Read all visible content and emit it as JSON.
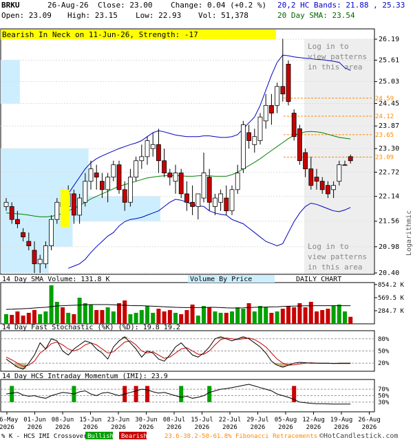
{
  "chart_data": {
    "type": "candlestick",
    "symbol": "BRKU",
    "header": {
      "date": "26-Aug-26",
      "close_label": "Close: 23.00",
      "change_label": "Change: 0.04 (+0.2 %)",
      "open_label": "Open: 23.09",
      "high_label": "High: 23.15",
      "low_label": "Low: 22.93",
      "vol_label": "Vol: 51,378",
      "bands_label": "20,2 HC Bands: 21.88 , 25.33",
      "sma_label": "20 Day SMA: 23.54"
    },
    "pattern_label": "Bearish In Neck on 11-Jun-26, Strength: -17",
    "login_label": "Log in to view patterns in this area",
    "price_axis": {
      "ticks": [
        "26.19",
        "25.61",
        "25.03",
        "24.45",
        "23.87",
        "23.30",
        "22.72",
        "22.14",
        "21.56",
        "20.98",
        "20.40"
      ],
      "scale_label": "Logarithmic",
      "ymin": 20.4,
      "ymax": 26.19
    },
    "fib_levels": [
      "24.59",
      "24.12",
      "23.65",
      "23.09"
    ],
    "x_ticks": [
      "26-May 2026",
      "01-Jun 2026",
      "08-Jun 2026",
      "15-Jun 2026",
      "23-Jun 2026",
      "30-Jun 2026",
      "08-Jul 2026",
      "15-Jul 2026",
      "22-Jul 2026",
      "29-Jul 2026",
      "05-Aug 2026",
      "12-Aug 2026",
      "19-Aug 2026",
      "26-Aug 2026"
    ],
    "candles": [
      [
        21.9,
        22.1,
        21.8,
        22.0
      ],
      [
        21.9,
        22.0,
        21.5,
        21.6
      ],
      [
        21.6,
        21.8,
        21.4,
        21.5
      ],
      [
        21.3,
        21.4,
        21.1,
        21.2
      ],
      [
        21.1,
        21.3,
        20.9,
        21.0
      ],
      [
        20.9,
        21.1,
        20.4,
        20.6
      ],
      [
        20.6,
        20.8,
        20.4,
        20.7
      ],
      [
        20.6,
        21.1,
        20.5,
        21.0
      ],
      [
        21.0,
        21.7,
        20.9,
        21.6
      ],
      [
        21.6,
        22.1,
        21.5,
        22.0
      ],
      [
        22.0,
        22.3,
        21.7,
        21.9
      ],
      [
        21.9,
        22.4,
        21.8,
        22.2
      ],
      [
        22.2,
        22.3,
        21.5,
        21.7
      ],
      [
        21.7,
        22.2,
        21.5,
        22.1
      ],
      [
        22.0,
        22.7,
        21.9,
        22.5
      ],
      [
        22.5,
        23.0,
        22.3,
        22.8
      ],
      [
        22.7,
        22.9,
        22.3,
        22.6
      ],
      [
        22.5,
        22.7,
        22.1,
        22.3
      ],
      [
        22.3,
        22.7,
        22.0,
        22.6
      ],
      [
        22.6,
        23.0,
        22.5,
        22.9
      ],
      [
        22.9,
        23.0,
        22.2,
        22.3
      ],
      [
        22.3,
        22.5,
        21.8,
        22.0
      ],
      [
        22.0,
        22.8,
        21.9,
        22.6
      ],
      [
        22.6,
        23.1,
        22.5,
        23.0
      ],
      [
        23.0,
        23.4,
        22.8,
        23.1
      ],
      [
        23.1,
        23.6,
        22.9,
        23.5
      ],
      [
        23.3,
        23.7,
        23.1,
        23.4
      ],
      [
        23.4,
        23.8,
        22.7,
        23.0
      ],
      [
        23.0,
        23.3,
        22.6,
        22.7
      ],
      [
        22.7,
        22.8,
        22.4,
        22.6
      ],
      [
        22.5,
        22.9,
        22.2,
        22.7
      ],
      [
        22.7,
        22.8,
        22.1,
        22.2
      ],
      [
        22.2,
        22.5,
        21.8,
        22.0
      ],
      [
        22.0,
        22.4,
        21.7,
        21.9
      ],
      [
        21.9,
        22.1,
        21.6,
        22.2
      ],
      [
        22.1,
        23.2,
        22.0,
        22.7
      ],
      [
        22.6,
        22.8,
        21.8,
        22.0
      ],
      [
        21.9,
        22.2,
        21.7,
        22.1
      ],
      [
        22.0,
        22.3,
        21.8,
        22.2
      ],
      [
        22.1,
        22.4,
        21.7,
        21.8
      ],
      [
        21.8,
        22.4,
        21.7,
        22.3
      ],
      [
        22.3,
        22.9,
        22.2,
        22.7
      ],
      [
        22.8,
        24.0,
        22.7,
        23.9
      ],
      [
        23.7,
        23.9,
        23.3,
        23.5
      ],
      [
        23.4,
        23.8,
        23.2,
        23.6
      ],
      [
        23.5,
        24.2,
        23.4,
        24.1
      ],
      [
        24.0,
        24.7,
        23.8,
        24.4
      ],
      [
        24.4,
        24.7,
        23.9,
        24.2
      ],
      [
        24.4,
        25.0,
        24.2,
        24.9
      ],
      [
        24.9,
        26.2,
        24.5,
        24.7
      ],
      [
        25.5,
        25.6,
        24.4,
        24.5
      ],
      [
        24.2,
        24.3,
        23.5,
        23.6
      ],
      [
        23.8,
        23.9,
        22.9,
        23.0
      ],
      [
        23.2,
        23.3,
        22.6,
        22.8
      ],
      [
        22.8,
        23.1,
        22.3,
        22.4
      ],
      [
        22.6,
        22.8,
        22.3,
        22.5
      ],
      [
        22.5,
        22.6,
        22.2,
        22.3
      ],
      [
        22.4,
        22.5,
        22.1,
        22.2
      ],
      [
        22.3,
        22.5,
        22.1,
        22.4
      ],
      [
        22.5,
        23.0,
        22.4,
        22.9
      ],
      [
        22.9,
        23.0,
        22.9,
        22.9
      ],
      [
        23.1,
        23.15,
        22.93,
        23.0
      ]
    ],
    "sma20": [
      21.75,
      21.74,
      21.73,
      21.72,
      21.7,
      21.68,
      21.66,
      21.66,
      21.67,
      21.7,
      21.74,
      21.8,
      21.86,
      21.92,
      22.0,
      22.08,
      22.14,
      22.2,
      22.26,
      22.32,
      22.38,
      22.42,
      22.46,
      22.5,
      22.54,
      22.58,
      22.6,
      22.62,
      22.63,
      22.64,
      22.64,
      22.63,
      22.62,
      22.62,
      22.63,
      22.64,
      22.63,
      22.62,
      22.62,
      22.62,
      22.66,
      22.72,
      22.8,
      22.88,
      22.96,
      23.05,
      23.15,
      23.25,
      23.35,
      23.45,
      23.55,
      23.63,
      23.68,
      23.72,
      23.73,
      23.72,
      23.7,
      23.66,
      23.62,
      23.58,
      23.56,
      23.54
    ],
    "upper_band": [
      null,
      null,
      null,
      null,
      null,
      null,
      null,
      null,
      null,
      null,
      null,
      22.2,
      22.4,
      22.6,
      22.8,
      22.95,
      23.05,
      23.12,
      23.18,
      23.24,
      23.3,
      23.35,
      23.4,
      23.44,
      23.5,
      23.6,
      23.7,
      23.75,
      23.72,
      23.68,
      23.64,
      23.62,
      23.6,
      23.6,
      23.6,
      23.62,
      23.62,
      23.6,
      23.58,
      23.58,
      23.6,
      23.65,
      23.8,
      23.95,
      24.1,
      24.4,
      24.8,
      25.2,
      25.55,
      25.75,
      25.73,
      25.7,
      25.68,
      25.66,
      25.65,
      25.63,
      25.62,
      25.6,
      25.58,
      25.55,
      25.4,
      25.33
    ],
    "lower_band": [
      null,
      null,
      null,
      null,
      null,
      null,
      null,
      null,
      null,
      null,
      null,
      20.5,
      20.55,
      20.6,
      20.7,
      20.85,
      20.98,
      21.1,
      21.22,
      21.3,
      21.45,
      21.55,
      21.6,
      21.62,
      21.65,
      21.7,
      21.75,
      21.8,
      21.9,
      22.0,
      22.07,
      22.05,
      22.0,
      21.95,
      21.92,
      21.9,
      21.8,
      21.75,
      21.72,
      21.7,
      21.6,
      21.55,
      21.5,
      21.4,
      21.3,
      21.2,
      21.1,
      21.05,
      21.0,
      21.05,
      21.3,
      21.55,
      21.75,
      21.9,
      21.98,
      21.95,
      21.9,
      21.85,
      21.8,
      21.78,
      21.82,
      21.88
    ],
    "volume_label": "14 Day SMA Volume: 131.8 K",
    "vbp_label": "Volume By Price",
    "daily_label": "DAILY CHART",
    "volume_ticks": [
      "854.2 K",
      "569.5 K",
      "284.7 K"
    ],
    "volume": [
      70,
      65,
      90,
      60,
      80,
      100,
      70,
      90,
      280,
      160,
      120,
      80,
      70,
      190,
      150,
      140,
      100,
      100,
      120,
      90,
      150,
      170,
      70,
      80,
      100,
      130,
      80,
      110,
      90,
      100,
      80,
      70,
      100,
      140,
      60,
      130,
      120,
      90,
      80,
      80,
      90,
      120,
      110,
      150,
      90,
      130,
      120,
      80,
      90,
      110,
      130,
      120,
      150,
      120,
      160,
      90,
      100,
      110,
      130,
      140,
      90,
      51
    ],
    "volume_sma": [
      105,
      106,
      108,
      110,
      112,
      115,
      118,
      120,
      125,
      130,
      132,
      134,
      135,
      136,
      138,
      140,
      140,
      140,
      140,
      138,
      136,
      135,
      133,
      132,
      132,
      130,
      128,
      126,
      124,
      122,
      120,
      119,
      118,
      118,
      118,
      118,
      120,
      120,
      118,
      116,
      115,
      115,
      116,
      118,
      120,
      121,
      122,
      123,
      124,
      126,
      128,
      129,
      130,
      131,
      131,
      132,
      132,
      132,
      132,
      132,
      132,
      131.8
    ],
    "vbp_bars": [
      {
        "from": 25.61,
        "to": 26.19,
        "value": 0
      },
      {
        "from": 24.45,
        "to": 25.61,
        "value": 0.12
      },
      {
        "from": 23.3,
        "to": 24.45,
        "value": 0.0
      },
      {
        "from": 22.14,
        "to": 23.3,
        "value": 0.55
      },
      {
        "from": 21.56,
        "to": 22.14,
        "value": 1.0
      },
      {
        "from": 20.98,
        "to": 21.56,
        "value": 0.45
      },
      {
        "from": 20.4,
        "to": 20.98,
        "value": 0.3
      }
    ],
    "stoch_label": "14 Day Fast Stochastic (%K) (%D): 19.8 19.2",
    "stoch_ticks": [
      "80%",
      "50%",
      "20%"
    ],
    "stoch_k": [
      30,
      20,
      10,
      5,
      20,
      40,
      70,
      55,
      80,
      75,
      50,
      40,
      55,
      65,
      75,
      70,
      55,
      45,
      30,
      60,
      75,
      85,
      70,
      55,
      35,
      50,
      45,
      30,
      25,
      40,
      60,
      70,
      55,
      40,
      35,
      45,
      60,
      80,
      85,
      80,
      75,
      80,
      85,
      80,
      70,
      60,
      45,
      25,
      15,
      10,
      15,
      20,
      22,
      21,
      20,
      19.8,
      20,
      20,
      19,
      20,
      20,
      19.8
    ],
    "stoch_d": [
      35,
      28,
      20,
      12,
      15,
      25,
      45,
      55,
      68,
      72,
      65,
      55,
      50,
      55,
      65,
      70,
      65,
      55,
      45,
      48,
      60,
      72,
      75,
      65,
      50,
      45,
      48,
      40,
      32,
      35,
      45,
      55,
      58,
      50,
      42,
      42,
      50,
      65,
      78,
      82,
      80,
      78,
      80,
      82,
      78,
      70,
      60,
      45,
      30,
      20,
      15,
      16,
      18,
      20,
      21,
      20,
      19.5,
      19.5,
      19.3,
      19.2,
      19.2,
      19.2
    ],
    "imi_label": "14 Day HCS Intraday Momentum (IMI): 23.9",
    "imi_ticks": [
      "70%",
      "50%",
      "30%"
    ],
    "imi": [
      55,
      58,
      60,
      52,
      48,
      50,
      45,
      42,
      50,
      55,
      60,
      58,
      55,
      62,
      65,
      55,
      50,
      58,
      60,
      55,
      50,
      55,
      60,
      65,
      70,
      68,
      62,
      58,
      60,
      55,
      50,
      45,
      48,
      42,
      45,
      50,
      60,
      65,
      70,
      72,
      75,
      78,
      82,
      85,
      80,
      75,
      70,
      65,
      55,
      50,
      45,
      38,
      30,
      28,
      26,
      25,
      25,
      24.5,
      24,
      24,
      24,
      23.9
    ],
    "crossovers": [
      {
        "i": 1,
        "kind": "bull"
      },
      {
        "i": 12,
        "kind": "bull"
      },
      {
        "i": 21,
        "kind": "bear"
      },
      {
        "i": 23,
        "kind": "bear"
      },
      {
        "i": 25,
        "kind": "bear"
      },
      {
        "i": 31,
        "kind": "bull"
      },
      {
        "i": 36,
        "kind": "bull"
      },
      {
        "i": 51,
        "kind": "bear"
      }
    ],
    "footer": {
      "legend_text": "% K - HCS IMI Crossover,",
      "bullish": "Bullish",
      "bearish": "Bearish",
      "fib_text": "23.6-38.2-50-61.8% Fibonacci Retracements",
      "copyright": "©HotCandlestick.com"
    },
    "colors": {
      "bull": "#00a000",
      "bear": "#c80000",
      "band": "#0000c0",
      "sma": "#008000",
      "vbp": "#cceeff",
      "header_blue": "#0000cc",
      "header_green": "#006600",
      "pattern_bg": "#ffff00",
      "fib": "#ff8800",
      "stoch_fill": "#c8b88a"
    }
  }
}
